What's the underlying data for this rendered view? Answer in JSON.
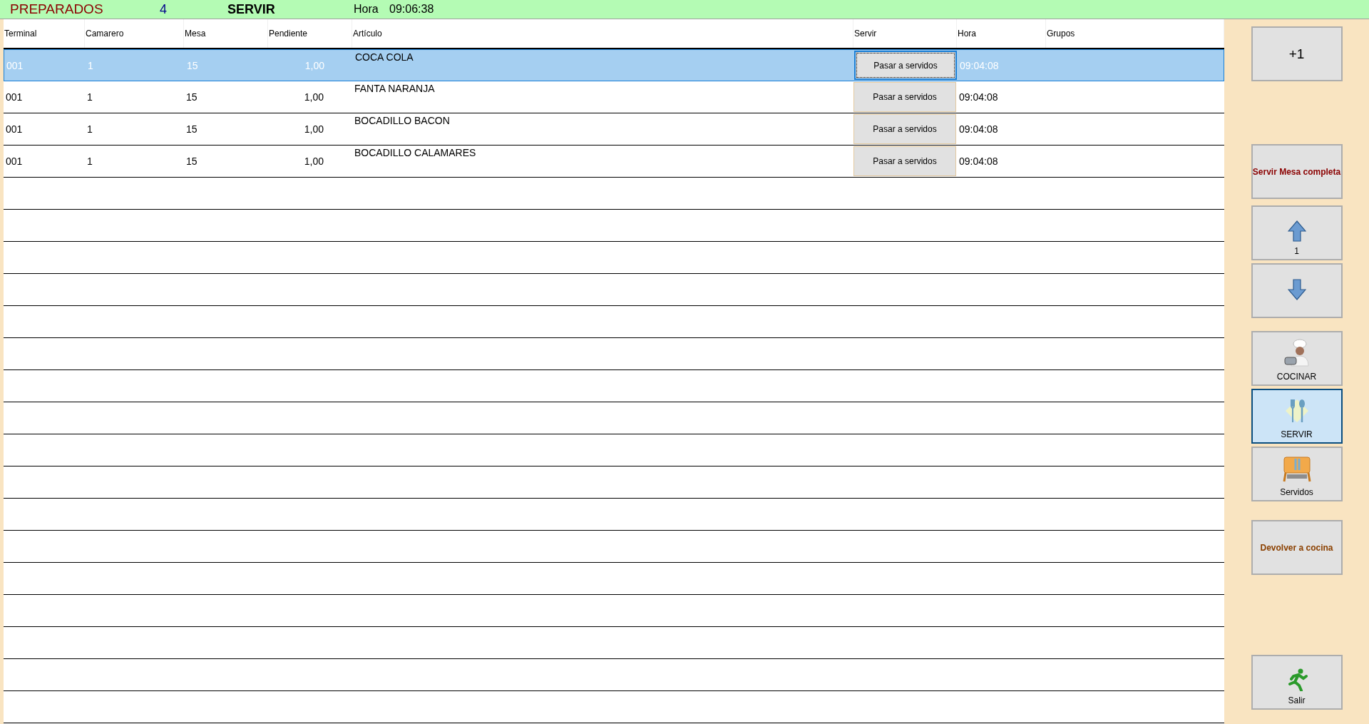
{
  "top_bar": {
    "title": "PREPARADOS",
    "count": "4",
    "mode": "SERVIR",
    "time_label": "Hora",
    "time": "09:06:38"
  },
  "table": {
    "columns": [
      "Terminal",
      "Camarero",
      "Mesa",
      "Pendiente",
      "Artículo",
      "Servir",
      "Hora",
      "Grupos"
    ],
    "rows": [
      {
        "selected": true,
        "terminal": "001",
        "camarero": "1",
        "mesa": "15",
        "pendiente": "1,00",
        "articulo": "COCA COLA",
        "action": "Pasar a servidos",
        "hora": "09:04:08"
      },
      {
        "selected": false,
        "terminal": "001",
        "camarero": "1",
        "mesa": "15",
        "pendiente": "1,00",
        "articulo": "FANTA NARANJA",
        "action": "Pasar a servidos",
        "hora": "09:04:08"
      },
      {
        "selected": false,
        "terminal": "001",
        "camarero": "1",
        "mesa": "15",
        "pendiente": "1,00",
        "articulo": "BOCADILLO BACON",
        "action": "Pasar a servidos",
        "hora": "09:04:08"
      },
      {
        "selected": false,
        "terminal": "001",
        "camarero": "1",
        "mesa": "15",
        "pendiente": "1,00",
        "articulo": "BOCADILLO CALAMARES",
        "action": "Pasar a servidos",
        "hora": "09:04:08"
      }
    ]
  },
  "side_buttons": [
    {
      "kind": "plus",
      "label": "+1",
      "selected": false
    },
    {
      "kind": "text",
      "label": "Servir Mesa completa",
      "selected": false
    },
    {
      "kind": "up",
      "label": "1",
      "selected": false
    },
    {
      "kind": "down",
      "selected": false
    },
    {
      "kind": "cook",
      "label": "COCINAR",
      "selected": false
    },
    {
      "kind": "serve",
      "label": "SERVIR",
      "selected": true
    },
    {
      "kind": "served",
      "label": "Servidos",
      "selected": false
    },
    {
      "kind": "text2",
      "label": "Devolver a cocina",
      "selected": false
    },
    {
      "kind": "exit",
      "label": "Salir",
      "selected": false
    }
  ]
}
